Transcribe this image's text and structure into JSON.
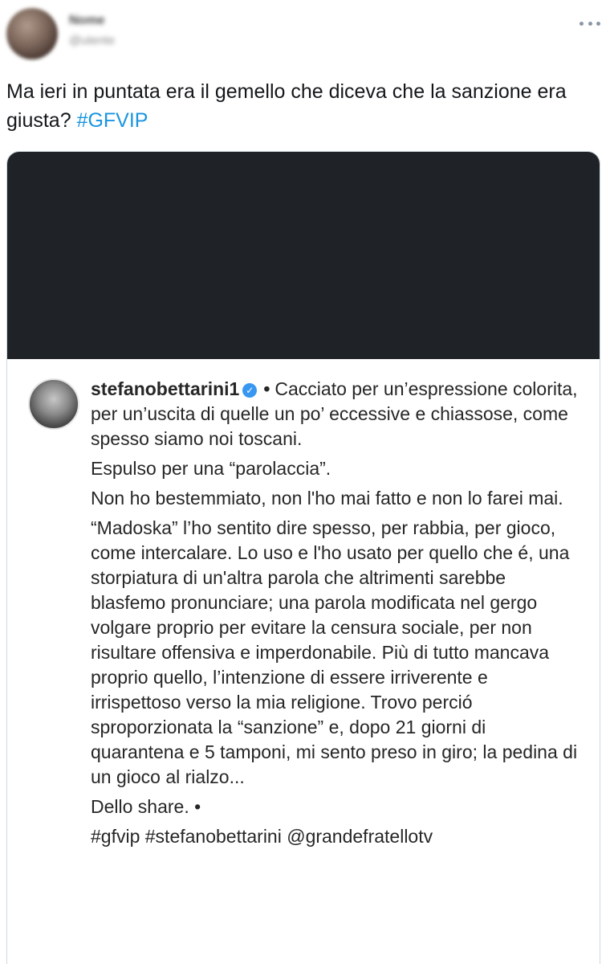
{
  "tweet": {
    "display_name": "Nome",
    "handle": "@utente",
    "text_prefix": "Ma ieri in puntata era il gemello che diceva che la sanzione era giusta? ",
    "hashtag": "#GFVIP"
  },
  "instagram_post": {
    "username": "stefanobettarini1",
    "verified_mark": "✓",
    "separator": "•",
    "paragraphs": [
      "Cacciato per un’espressione colorita, per un’uscita di quelle un po’ eccessive e chiassose, come spesso siamo noi toscani.",
      "Espulso per una “parolaccia”.",
      "Non ho bestemmiato, non l'ho mai fatto e non lo farei mai.",
      "“Madoska” l’ho sentito dire spesso, per rabbia, per gioco, come intercalare. Lo uso e l'ho usato per quello che é, una storpiatura  di un'altra parola che altrimenti sarebbe blasfemo pronunciare; una parola modificata nel gergo volgare proprio per evitare la censura sociale, per non risultare offensiva e imperdonabile. Più di tutto mancava proprio quello, l’intenzione di essere irriverente e irrispettoso verso la mia religione. Trovo perció sproporzionata la “sanzione” e, dopo 21 giorni di quarantena e 5 tamponi, mi sento preso in giro; la pedina di un gioco al rialzo...",
      "Dello share. •",
      "#gfvip #stefanobettarini @grandefratellotv"
    ]
  },
  "colors": {
    "hashtag": "#1b95e0",
    "dark_band": "#1f2328",
    "verified": "#3897f0"
  },
  "icons": {
    "more": "more-horizontal-icon",
    "verified": "verified-badge-icon"
  }
}
